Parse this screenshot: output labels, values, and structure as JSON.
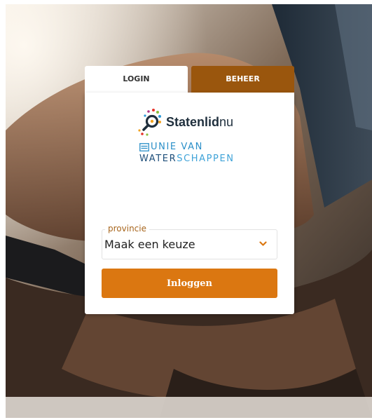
{
  "tabs": [
    {
      "label": "LOGIN",
      "active": true
    },
    {
      "label": "BEHEER",
      "active": false
    }
  ],
  "logos": {
    "statenlid": {
      "name": "Statenlid",
      "suffix": "nu"
    },
    "unie_van_waterschappen": {
      "line1": "UNIE VAN",
      "line2_a": "WATER",
      "line2_b": "SCHAPPEN"
    }
  },
  "form": {
    "province": {
      "label": "provincie",
      "value": "Maak een keuze"
    },
    "login_button": "Inloggen"
  },
  "colors": {
    "accent": "#db7711",
    "tab_inactive": "#9a560d",
    "label": "#a7651c",
    "uvw_dark": "#1f4f7a",
    "uvw_light": "#3fa3d8"
  },
  "icons": {
    "statenlid_logo": "magnifier-dots-logo",
    "uvw_logo": "waves-box-logo",
    "select": "chevron-down-icon"
  }
}
